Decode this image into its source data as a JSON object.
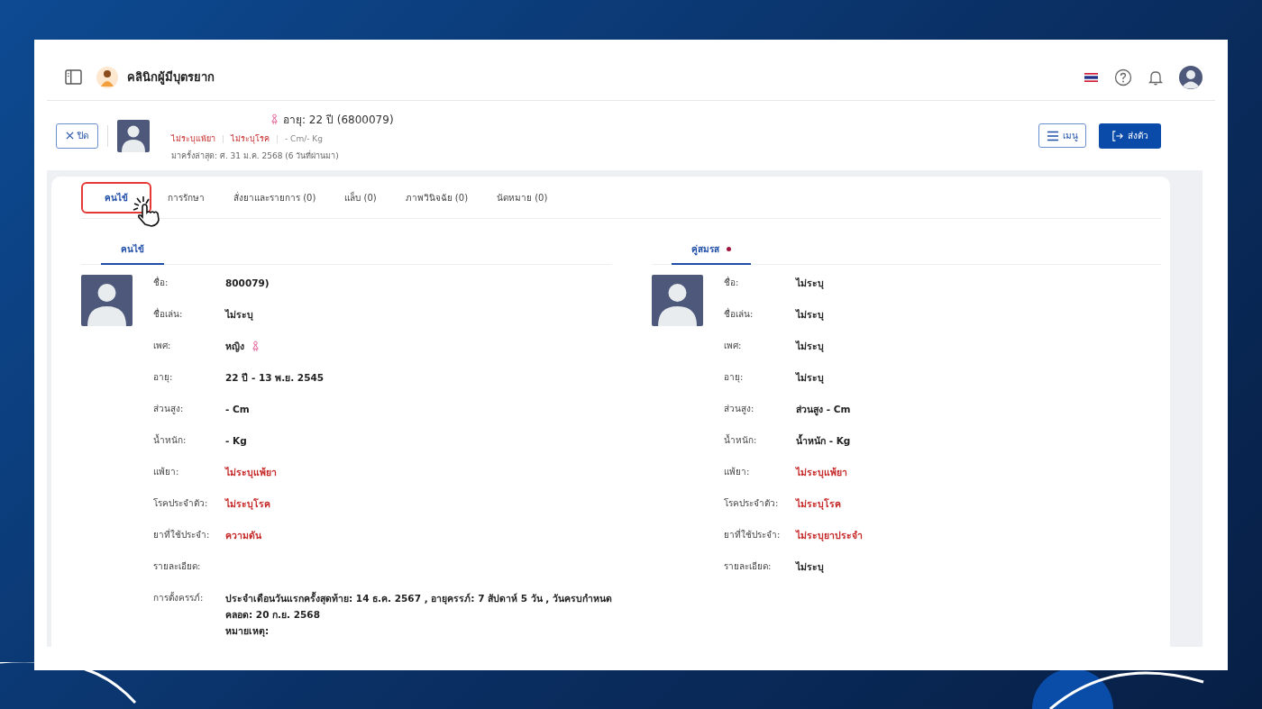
{
  "topbar": {
    "clinic_name": "คลินิกผู้มีบุตรยาก"
  },
  "patient_header": {
    "close_button": "ปิด",
    "age_id": "อายุ: 22 ปี (6800079)",
    "tags": [
      {
        "text": "ไม่ระบุแพ้ยา",
        "kind": "alert"
      },
      {
        "text": "ไม่ระบุโรค",
        "kind": "alert"
      },
      {
        "text": "- Cm/- Kg",
        "kind": "normal"
      }
    ],
    "last_visit": "มาครั้งล่าสุด: ศ. 31 ม.ค. 2568 (6 วันที่ผ่านมา)",
    "menu_button": "เมนู",
    "send_button": "ส่งตัว"
  },
  "tabs": [
    {
      "label": "คนไข้",
      "selected": true,
      "highlighted": true
    },
    {
      "label": "การรักษา",
      "selected": false,
      "highlighted": false
    },
    {
      "label": "สั่งยาและรายการ (0)",
      "selected": false,
      "highlighted": false
    },
    {
      "label": "แล็บ (0)",
      "selected": false,
      "highlighted": false
    },
    {
      "label": "ภาพวินิจฉัย (0)",
      "selected": false,
      "highlighted": false
    },
    {
      "label": "นัดหมาย (0)",
      "selected": false,
      "highlighted": false
    }
  ],
  "panels": [
    {
      "tab": {
        "label": "คนไข้",
        "selected": true
      },
      "fields": [
        {
          "label": "ชื่อ:",
          "value": [
            "800079)"
          ],
          "kind": "normal"
        },
        {
          "label": "ชื่อเล่น:",
          "value": [
            "ไม่ระบุ"
          ],
          "kind": "normal"
        },
        {
          "label": "เพศ:",
          "value": [
            "หญิง"
          ],
          "kind": "female"
        },
        {
          "label": "อายุ:",
          "value": [
            "22 ปี - 13 พ.ย. 2545"
          ],
          "kind": "normal"
        },
        {
          "label": "ส่วนสูง:",
          "value": [
            "- Cm"
          ],
          "kind": "normal"
        },
        {
          "label": "น้ำหนัก:",
          "value": [
            "- Kg"
          ],
          "kind": "normal"
        },
        {
          "label": "แพ้ยา:",
          "value": [
            "ไม่ระบุแพ้ยา"
          ],
          "kind": "alert"
        },
        {
          "label": "โรคประจำตัว:",
          "value": [
            "ไม่ระบุโรค"
          ],
          "kind": "alert"
        },
        {
          "label": "ยาที่ใช้ประจำ:",
          "value": [
            "ความดัน"
          ],
          "kind": "alert"
        },
        {
          "label": "รายละเอียด:",
          "kind": "normal"
        },
        {
          "label": "การตั้งครรภ์:",
          "value": [
            "ประจำเดือนวันแรกครั้งสุดท้าย: 14 ธ.ค. 2567 , อายุครรภ์: 7 สัปดาห์ 5 วัน , วันครบกำหนด",
            "คลอด: 20 ก.ย. 2568",
            "หมายเหตุ:"
          ],
          "kind": "normal"
        }
      ]
    },
    {
      "tab": {
        "label": "คู่สมรส",
        "selected": true,
        "color": "#a0153e"
      },
      "fields": [
        {
          "label": "ชื่อ:",
          "value": [
            "ไม่ระบุ"
          ],
          "kind": "normal"
        },
        {
          "label": "ชื่อเล่น:",
          "value": [
            "ไม่ระบุ"
          ],
          "kind": "normal"
        },
        {
          "label": "เพศ:",
          "value": [
            "ไม่ระบุ"
          ],
          "kind": "normal"
        },
        {
          "label": "อายุ:",
          "value": [
            "ไม่ระบุ"
          ],
          "kind": "normal"
        },
        {
          "label": "ส่วนสูง:",
          "value": [
            "ส่วนสูง - Cm"
          ],
          "kind": "normal"
        },
        {
          "label": "น้ำหนัก:",
          "value": [
            "น้ำหนัก - Kg"
          ],
          "kind": "normal"
        },
        {
          "label": "แพ้ยา:",
          "value": [
            "ไม่ระบุแพ้ยา"
          ],
          "kind": "alert"
        },
        {
          "label": "โรคประจำตัว:",
          "value": [
            "ไม่ระบุโรค"
          ],
          "kind": "alert"
        },
        {
          "label": "ยาที่ใช้ประจำ:",
          "value": [
            "ไม่ระบุยาประจำ"
          ],
          "kind": "alert"
        },
        {
          "label": "รายละเอียด:",
          "value": [
            "ไม่ระบุ"
          ],
          "kind": "normal"
        }
      ]
    }
  ]
}
